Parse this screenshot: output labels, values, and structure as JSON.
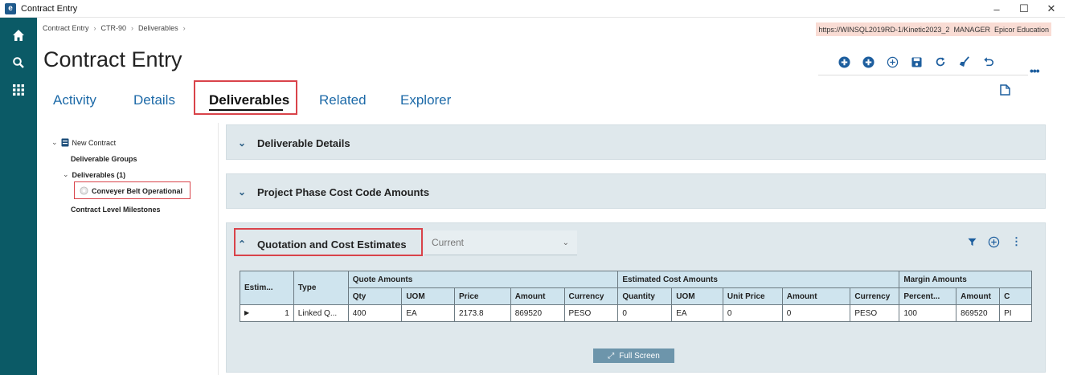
{
  "window": {
    "title": "Contract Entry",
    "controls": {
      "minimize": "–",
      "maximize": "☐",
      "close": "✕"
    }
  },
  "breadcrumb": [
    "Contract Entry",
    "CTR-90",
    "Deliverables"
  ],
  "environment": {
    "url": "https://WINSQL2019RD-1/Kinetic2023_2",
    "user": "MANAGER",
    "company": "Epicor Education"
  },
  "page_title": "Contract Entry",
  "tabs": [
    {
      "label": "Activity"
    },
    {
      "label": "Details"
    },
    {
      "label": "Deliverables",
      "active": true
    },
    {
      "label": "Related"
    },
    {
      "label": "Explorer"
    }
  ],
  "tree": {
    "root": "New Contract",
    "items": [
      {
        "label": "Deliverable Groups"
      },
      {
        "label": "Deliverables (1)"
      },
      {
        "label": "Conveyer Belt Operational"
      },
      {
        "label": "Contract Level Milestones"
      }
    ]
  },
  "panels": {
    "deliverable_details": "Deliverable Details",
    "project_phase": "Project Phase Cost Code Amounts",
    "quotation": "Quotation and Cost Estimates"
  },
  "filter": {
    "selected": "Current"
  },
  "grid": {
    "groups": {
      "quote": "Quote Amounts",
      "estimated": "Estimated Cost Amounts",
      "margin": "Margin Amounts"
    },
    "headers": {
      "estim": "Estim...",
      "type": "Type",
      "qty": "Qty",
      "uom": "UOM",
      "price": "Price",
      "amount": "Amount",
      "currency": "Currency",
      "quantity": "Quantity",
      "uom2": "UOM",
      "unit_price": "Unit Price",
      "amount2": "Amount",
      "currency2": "Currency",
      "percent": "Percent...",
      "amount3": "Amount",
      "more": "C"
    },
    "row": {
      "estim": "1",
      "type": "Linked Q...",
      "qty": "400",
      "uom": "EA",
      "price": "2173.8",
      "amount": "869520",
      "currency": "PESO",
      "quantity": "0",
      "uom2": "EA",
      "unit_price": "0",
      "amount2": "0",
      "currency2": "PESO",
      "percent": "100",
      "amount3": "869520",
      "more": "PI"
    }
  },
  "full_screen_label": "Full Screen",
  "colors": {
    "rail": "#0b5a66",
    "accent": "#1d6aa8",
    "highlight_box": "#d9434a",
    "panel_bg": "#dfe8ec",
    "grid_header": "#cfe4ee"
  }
}
